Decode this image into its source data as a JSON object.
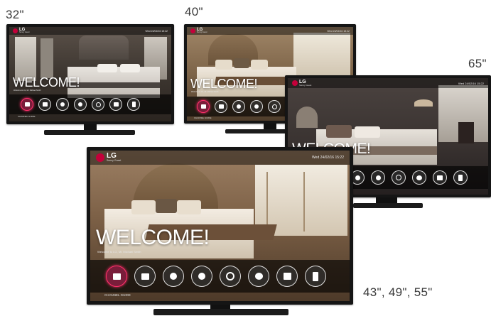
{
  "labels": {
    "size_32": "32\"",
    "size_40": "40\"",
    "size_65": "65\"",
    "size_large": "43\", 49\", 55\""
  },
  "screen": {
    "logo": "LG",
    "logo_sub": "Sunny Guest",
    "welcome": "WELCOME!",
    "greeting": "Welcome to LG, Mr. Michael Smith",
    "clock": "Wed 24/02/16 15:22",
    "menu_caption": "CHANNEL GUIDE",
    "menu_icons": [
      "tv-icon",
      "briefcase-icon",
      "info-icon",
      "info-icon",
      "globe-icon",
      "alarm-icon",
      "bag-icon",
      "phone-icon"
    ]
  },
  "colors": {
    "brand": "#c4003a",
    "selected_ring": "#ff2f6b",
    "bezel": "#151515"
  }
}
